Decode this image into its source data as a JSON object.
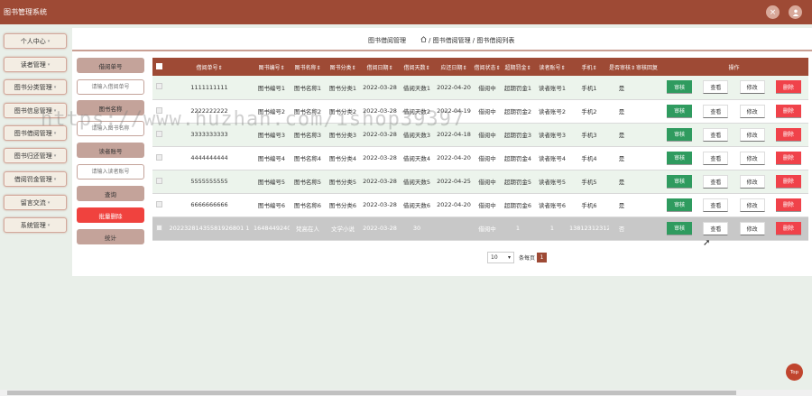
{
  "header": {
    "title": "图书管理系统",
    "icon_close": "×",
    "icon_user": "user-icon"
  },
  "sidebar": {
    "items": [
      {
        "label": "个人中心"
      },
      {
        "label": "读者管理"
      },
      {
        "label": "图书分类管理"
      },
      {
        "label": "图书信息管理"
      },
      {
        "label": "图书借阅管理"
      },
      {
        "label": "图书归还管理"
      },
      {
        "label": "借阅罚金管理"
      },
      {
        "label": "留言交流"
      },
      {
        "label": "系统管理"
      }
    ]
  },
  "breadcrumb": {
    "title": "图书借阅管理",
    "path": "/ 图书借阅管理 / 图书借阅列表"
  },
  "search": {
    "label_borrow_no": "借阅单号",
    "placeholder_borrow_no": "请输入借阅单号",
    "label_book_name": "图书名称",
    "placeholder_book_name": "请输入图书名称",
    "label_reader_no": "读者账号",
    "placeholder_reader_no": "请输入读者账号",
    "btn_search": "查询",
    "btn_batch_delete": "批量删除",
    "btn_stats": "统计"
  },
  "table": {
    "headers": [
      "借阅单号",
      "图书编号",
      "图书名称",
      "图书分类",
      "借阅日期",
      "借阅天数",
      "应还日期",
      "借阅状态",
      "超期罚金",
      "读者账号",
      "手机",
      "是否审核",
      "审核回复",
      "操作"
    ],
    "rows": [
      [
        "1111111111",
        "图书编号1",
        "图书名称1",
        "图书分类1",
        "2022-03-28",
        "借阅天数1",
        "2022-04-20",
        "借阅中",
        "超期罚金1",
        "读者账号1",
        "手机1",
        "是",
        ""
      ],
      [
        "2222222222",
        "图书编号2",
        "图书名称2",
        "图书分类2",
        "2022-03-28",
        "借阅天数2",
        "2022-04-19",
        "借阅中",
        "超期罚金2",
        "读者账号2",
        "手机2",
        "是",
        ""
      ],
      [
        "3333333333",
        "图书编号3",
        "图书名称3",
        "图书分类3",
        "2022-03-28",
        "借阅天数3",
        "2022-04-18",
        "借阅中",
        "超期罚金3",
        "读者账号3",
        "手机3",
        "是",
        ""
      ],
      [
        "4444444444",
        "图书编号4",
        "图书名称4",
        "图书分类4",
        "2022-03-28",
        "借阅天数4",
        "2022-04-20",
        "借阅中",
        "超期罚金4",
        "读者账号4",
        "手机4",
        "是",
        ""
      ],
      [
        "5555555555",
        "图书编号5",
        "图书名称5",
        "图书分类5",
        "2022-03-28",
        "借阅天数5",
        "2022-04-25",
        "借阅中",
        "超期罚金5",
        "读者账号5",
        "手机5",
        "是",
        ""
      ],
      [
        "6666666666",
        "图书编号6",
        "图书名称6",
        "图书分类6",
        "2022-03-28",
        "借阅天数6",
        "2022-04-20",
        "借阅中",
        "超期罚金6",
        "读者账号6",
        "手机6",
        "是",
        ""
      ],
      [
        "20223281435581926801 1",
        "1648449240",
        "梵高在人",
        "文学小说",
        "2022-03-28",
        "30",
        "",
        "借阅中",
        "1",
        "1",
        "13812312312",
        "否",
        ""
      ]
    ],
    "op_audit": "审核",
    "op_view": "查看",
    "op_edit": "修改",
    "op_delete": "删除"
  },
  "pager": {
    "page_size": "10",
    "per_page_label": "条每页",
    "current_page": "1"
  },
  "top_button": "Top",
  "watermark": "https://www.huzhan.com/ishop39397",
  "colors": {
    "brand": "#9e4a35",
    "audit": "#2f9b5f",
    "danger": "#f0424a"
  }
}
